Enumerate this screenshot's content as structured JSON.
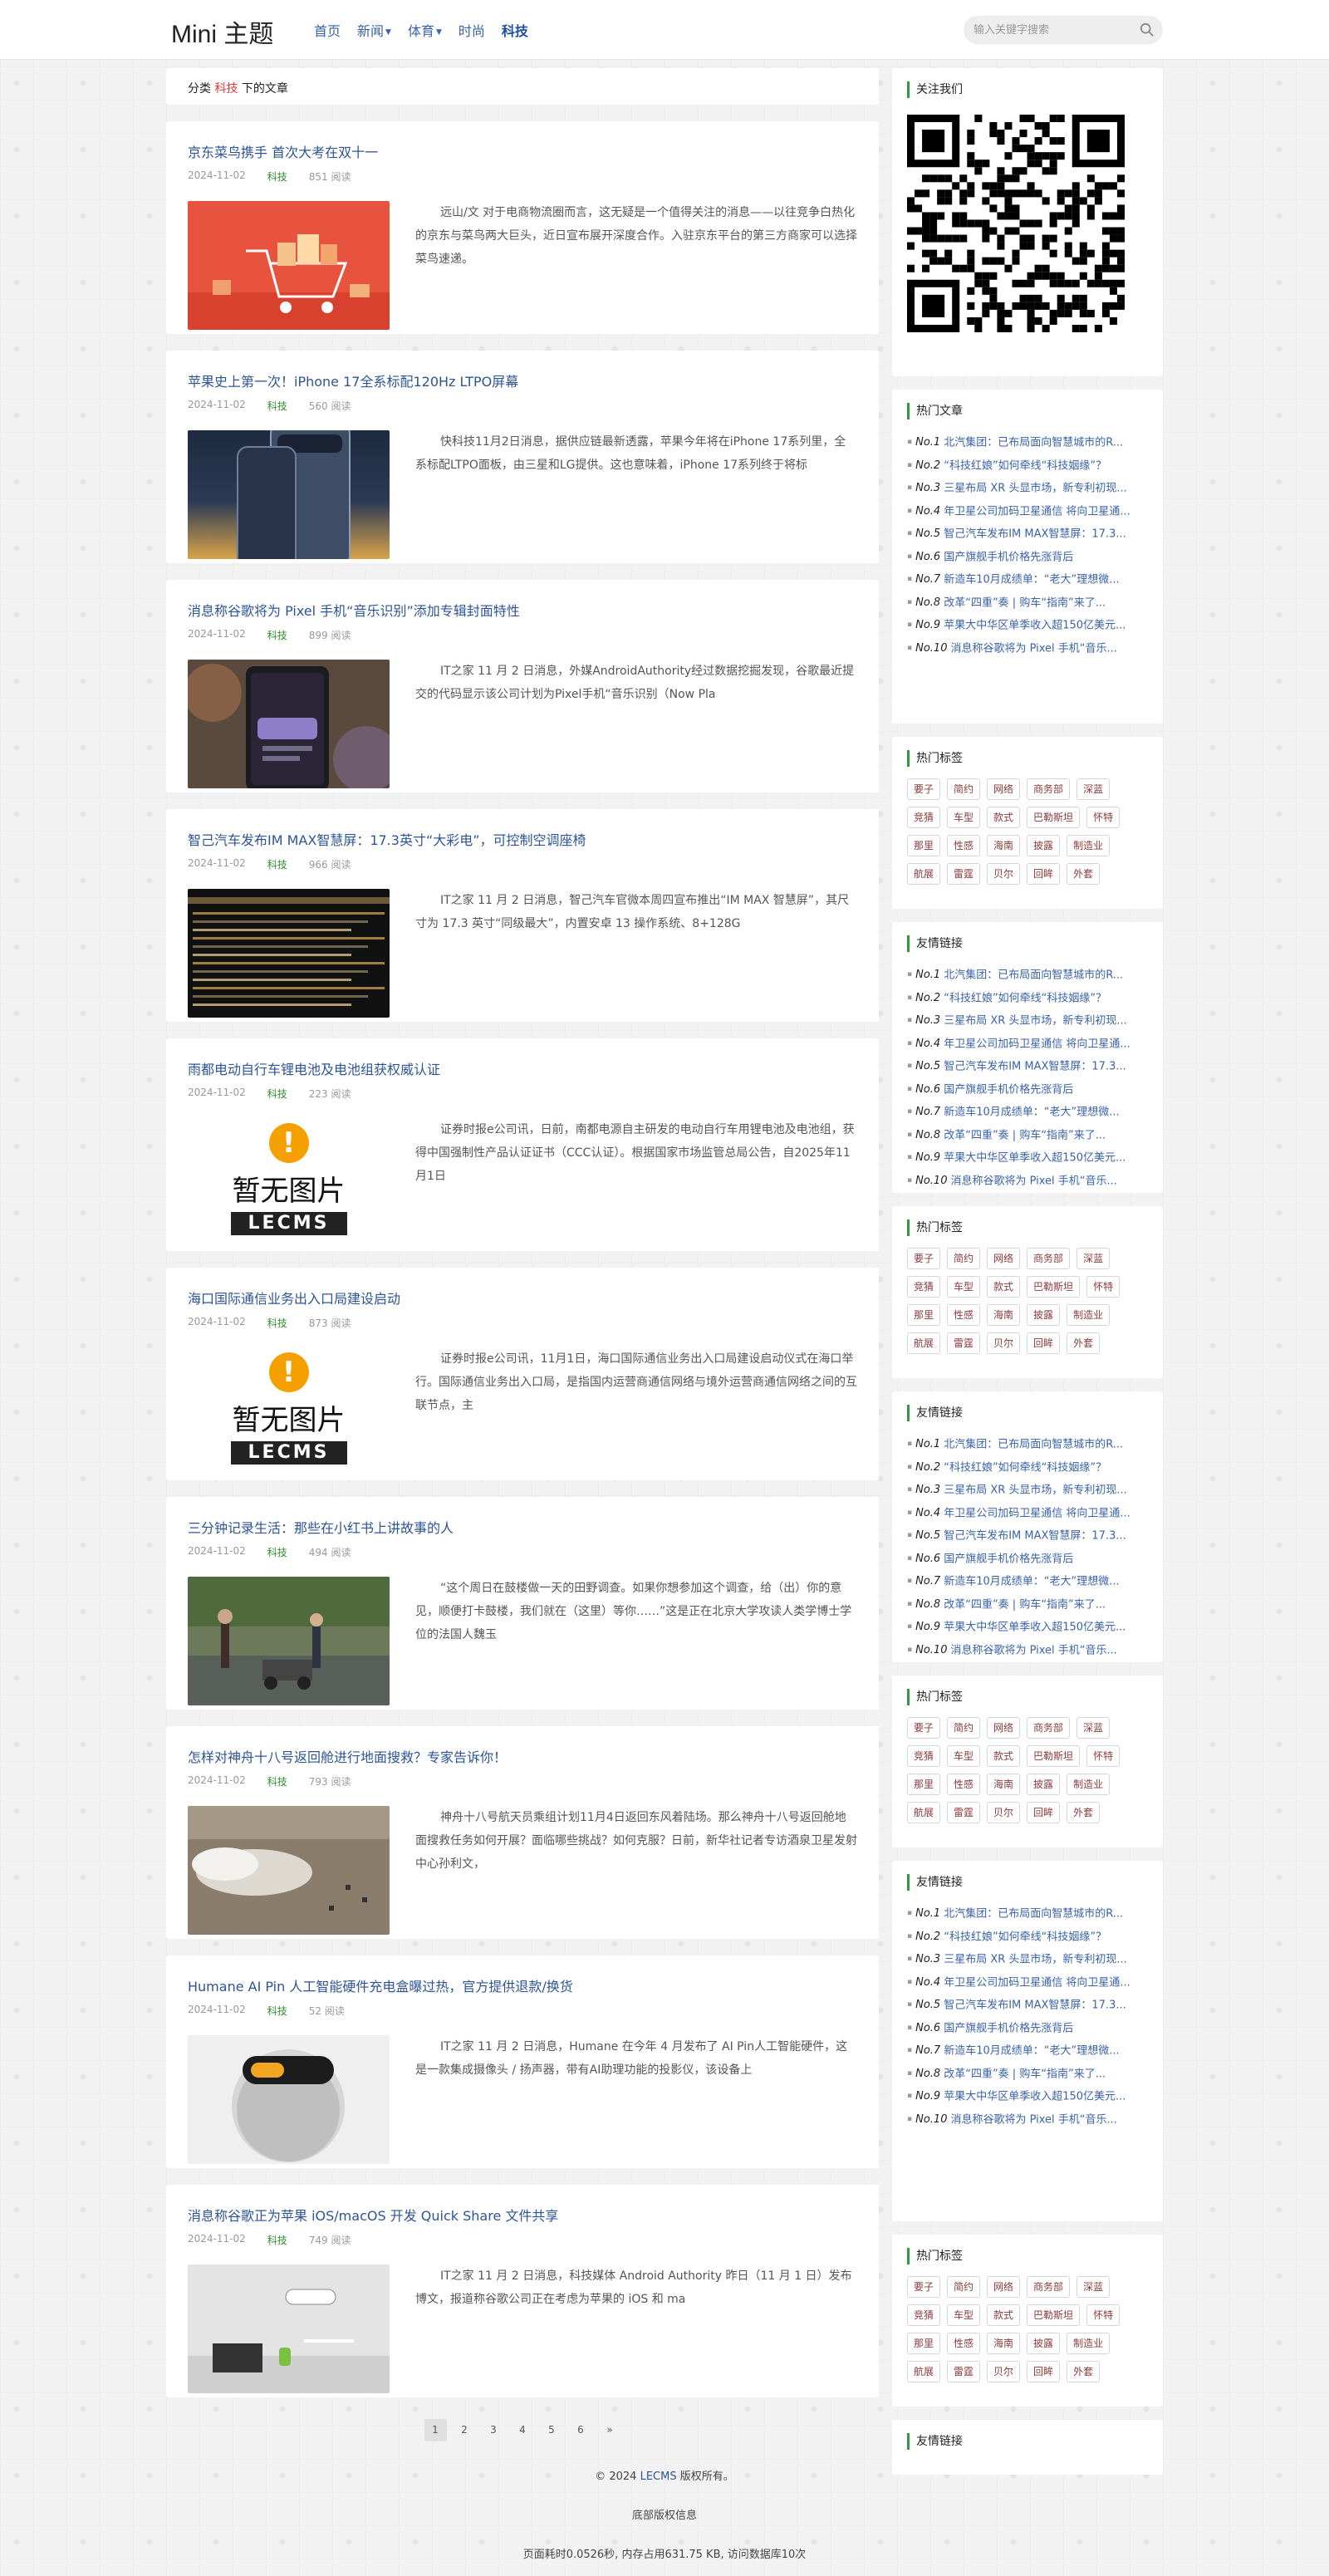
{
  "header": {
    "logo": "Mini 主题",
    "nav": [
      {
        "label": "首页",
        "dropdown": false,
        "active": false
      },
      {
        "label": "新闻",
        "dropdown": true,
        "active": false
      },
      {
        "label": "体育",
        "dropdown": true,
        "active": false
      },
      {
        "label": "时尚",
        "dropdown": false,
        "active": false
      },
      {
        "label": "科技",
        "dropdown": false,
        "active": true
      }
    ],
    "search_placeholder": "输入关键字搜索"
  },
  "category": {
    "prefix": "分类",
    "name": "科技",
    "suffix": "下的文章"
  },
  "posts": [
    {
      "title": "京东菜鸟携手 首次大考在双十一",
      "date": "2024-11-02",
      "tag": "科技",
      "views": "851 阅读",
      "thumb": "cart",
      "excerpt": "远山/文 对于电商物流圈而言，这无疑是一个值得关注的消息——以往竞争白热化的京东与菜鸟两大巨头，近日宣布展开深度合作。入驻京东平台的第三方商家可以选择菜鸟速递。"
    },
    {
      "title": "苹果史上第一次！iPhone 17全系标配120Hz LTPO屏幕",
      "date": "2024-11-02",
      "tag": "科技",
      "views": "560 阅读",
      "thumb": "phone",
      "excerpt": "快科技11月2日消息，据供应链最新透露，苹果今年将在iPhone 17系列里，全系标配LTPO面板，由三星和LG提供。这也意味着，iPhone 17系列终于将标"
    },
    {
      "title": "消息称谷歌将为 Pixel 手机“音乐识别”添加专辑封面特性",
      "date": "2024-11-02",
      "tag": "科技",
      "views": "899 阅读",
      "thumb": "pixel",
      "excerpt": "IT之家 11 月 2 日消息，外媒AndroidAuthority经过数据挖掘发现，谷歌最近提交的代码显示该公司计划为Pixel手机“音乐识别（Now Pla"
    },
    {
      "title": "智己汽车发布IM MAX智慧屏：17.3英寸“大彩电”，可控制空调座椅",
      "date": "2024-11-02",
      "tag": "科技",
      "views": "966 阅读",
      "thumb": "screen",
      "excerpt": "IT之家 11 月 2 日消息，智己汽车官微本周四宣布推出“IM MAX 智慧屏”，其尺寸为 17.3 英寸“同级最大”，内置安卓 13 操作系统、8+128G"
    },
    {
      "title": "雨都电动自行车锂电池及电池组获权威认证",
      "date": "2024-11-02",
      "tag": "科技",
      "views": "223 阅读",
      "thumb": "noimg",
      "excerpt": "证券时报e公司讯，日前，南都电源自主研发的电动自行车用锂电池及电池组，获得中国强制性产品认证证书（CCC认证）。根据国家市场监管总局公告，自2025年11月1日"
    },
    {
      "title": "海口国际通信业务出入口局建设启动",
      "date": "2024-11-02",
      "tag": "科技",
      "views": "873 阅读",
      "thumb": "noimg",
      "excerpt": "证券时报e公司讯，11月1日，海口国际通信业务出入口局建设启动仪式在海口举行。国际通信业务出入口局，是指国内运营商通信网络与境外运营商通信网络之间的互联节点，主"
    },
    {
      "title": "三分钟记录生活：那些在小红书上讲故事的人",
      "date": "2024-11-02",
      "tag": "科技",
      "views": "494 阅读",
      "thumb": "street",
      "excerpt": "“这个周日在鼓楼做一天的田野调查。如果你想参加这个调查，给（出）你的意见，顺便打卡鼓楼，我们就在（这里）等你……”这是正在北京大学攻读人类学博士学位的法国人魏玉"
    },
    {
      "title": "怎样对神舟十八号返回舱进行地面搜救？专家告诉你！",
      "date": "2024-11-02",
      "tag": "科技",
      "views": "793 阅读",
      "thumb": "landing",
      "excerpt": "神舟十八号航天员乘组计划11月4日返回东风着陆场。那么神舟十八号返回舱地面搜救任务如何开展？面临哪些挑战？如何克服？日前，新华社记者专访酒泉卫星发射中心孙利文，"
    },
    {
      "title": "Humane AI Pin 人工智能硬件充电盒曝过热，官方提供退款/换货",
      "date": "2024-11-02",
      "tag": "科技",
      "views": "52 阅读",
      "thumb": "pin",
      "excerpt": "IT之家 11 月 2 日消息，Humane 在今年 4 月发布了 AI Pin人工智能硬件，这是一款集成摄像头 / 扬声器，带有AI助理功能的投影仪，该设备上"
    },
    {
      "title": "消息称谷歌正为苹果 iOS/macOS 开发 Quick Share 文件共享",
      "date": "2024-11-02",
      "tag": "科技",
      "views": "749 阅读",
      "thumb": "share",
      "excerpt": "IT之家 11 月 2 日消息，科技媒体 Android Authority 昨日（11 月 1 日）发布博文，报道称谷歌公司正在考虑为苹果的 iOS 和 ma"
    }
  ],
  "noimg": {
    "text": "暂无图片",
    "brand": "LECMS"
  },
  "pagination": [
    "1",
    "2",
    "3",
    "4",
    "5",
    "6",
    "»"
  ],
  "sidebar": {
    "follow_title": "关注我们",
    "hot_title": "热门文章",
    "tags_title": "热门标签",
    "links_title": "友情链接",
    "hot_articles": [
      {
        "n": "No.1",
        "t": "北汽集团：已布局面向智慧城市的R..."
      },
      {
        "n": "No.2",
        "t": "“科技红娘”如何牵线“科技姻缘”？"
      },
      {
        "n": "No.3",
        "t": "三星布局 XR 头显市场，新专利初现..."
      },
      {
        "n": "No.4",
        "t": "年卫星公司加码卫星通信 将向卫星通..."
      },
      {
        "n": "No.5",
        "t": "智己汽车发布IM MAX智慧屏：17.3..."
      },
      {
        "n": "No.6",
        "t": "国产旗舰手机价格先涨背后"
      },
      {
        "n": "No.7",
        "t": "新造车10月成绩单：“老大”理想微..."
      },
      {
        "n": "No.8",
        "t": "改革“四重”奏 | 购车“指南”来了..."
      },
      {
        "n": "No.9",
        "t": "苹果大中华区单季收入超150亿美元..."
      },
      {
        "n": "No.10",
        "t": "消息称谷歌将为 Pixel 手机“音乐..."
      }
    ],
    "tags": [
      "要子",
      "简约",
      "网络",
      "商务部",
      "深蓝",
      "竞猜",
      "车型",
      "款式",
      "巴勒斯坦",
      "怀特",
      "那里",
      "性感",
      "海南",
      "披露",
      "制造业",
      "航展",
      "雷霆",
      "贝尔",
      "回眸",
      "外套"
    ]
  },
  "footer": {
    "copyright_pre": "© 2024",
    "copyright_link": "LECMS",
    "copyright_post": "版权所有。",
    "bottom_info": "底部版权信息",
    "stats": "页面耗时0.0526秒, 内存占用631.75 KB, 访问数据库10次"
  }
}
